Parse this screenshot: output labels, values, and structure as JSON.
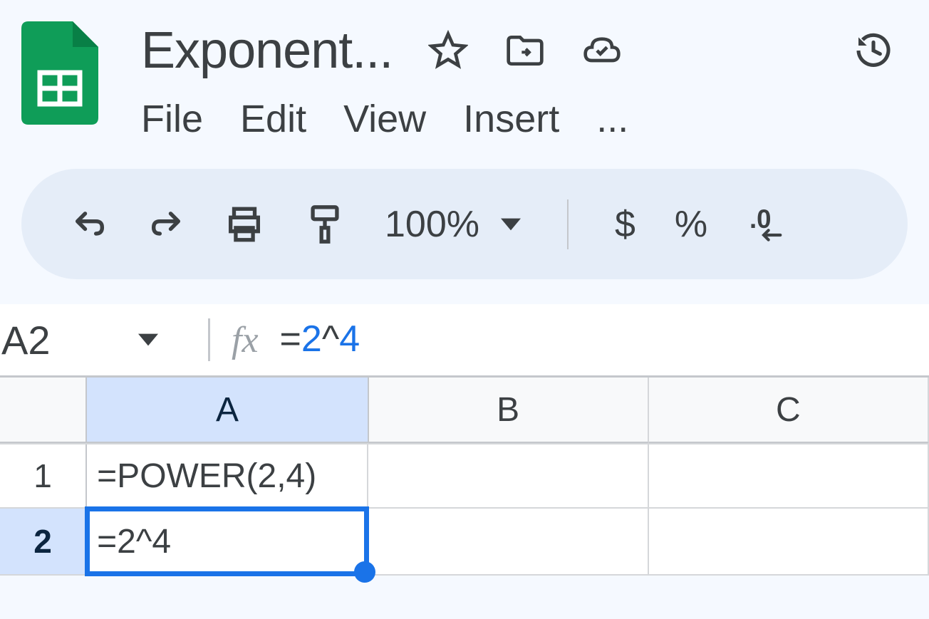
{
  "document": {
    "title": "Exponent..."
  },
  "menus": {
    "file": "File",
    "edit": "Edit",
    "view": "View",
    "insert": "Insert",
    "more": "..."
  },
  "toolbar": {
    "zoom": "100%"
  },
  "formula_bar": {
    "cell_reference": "A2",
    "fx_label": "fx",
    "formula_equals": "=",
    "formula_num1": "2",
    "formula_op": "^",
    "formula_num2": "4"
  },
  "grid": {
    "columns": {
      "a": "A",
      "b": "B",
      "c": "C"
    },
    "rows": {
      "r1": "1",
      "r2": "2"
    },
    "cells": {
      "a1": "=POWER(2,4)",
      "a2": "=2^4"
    }
  }
}
